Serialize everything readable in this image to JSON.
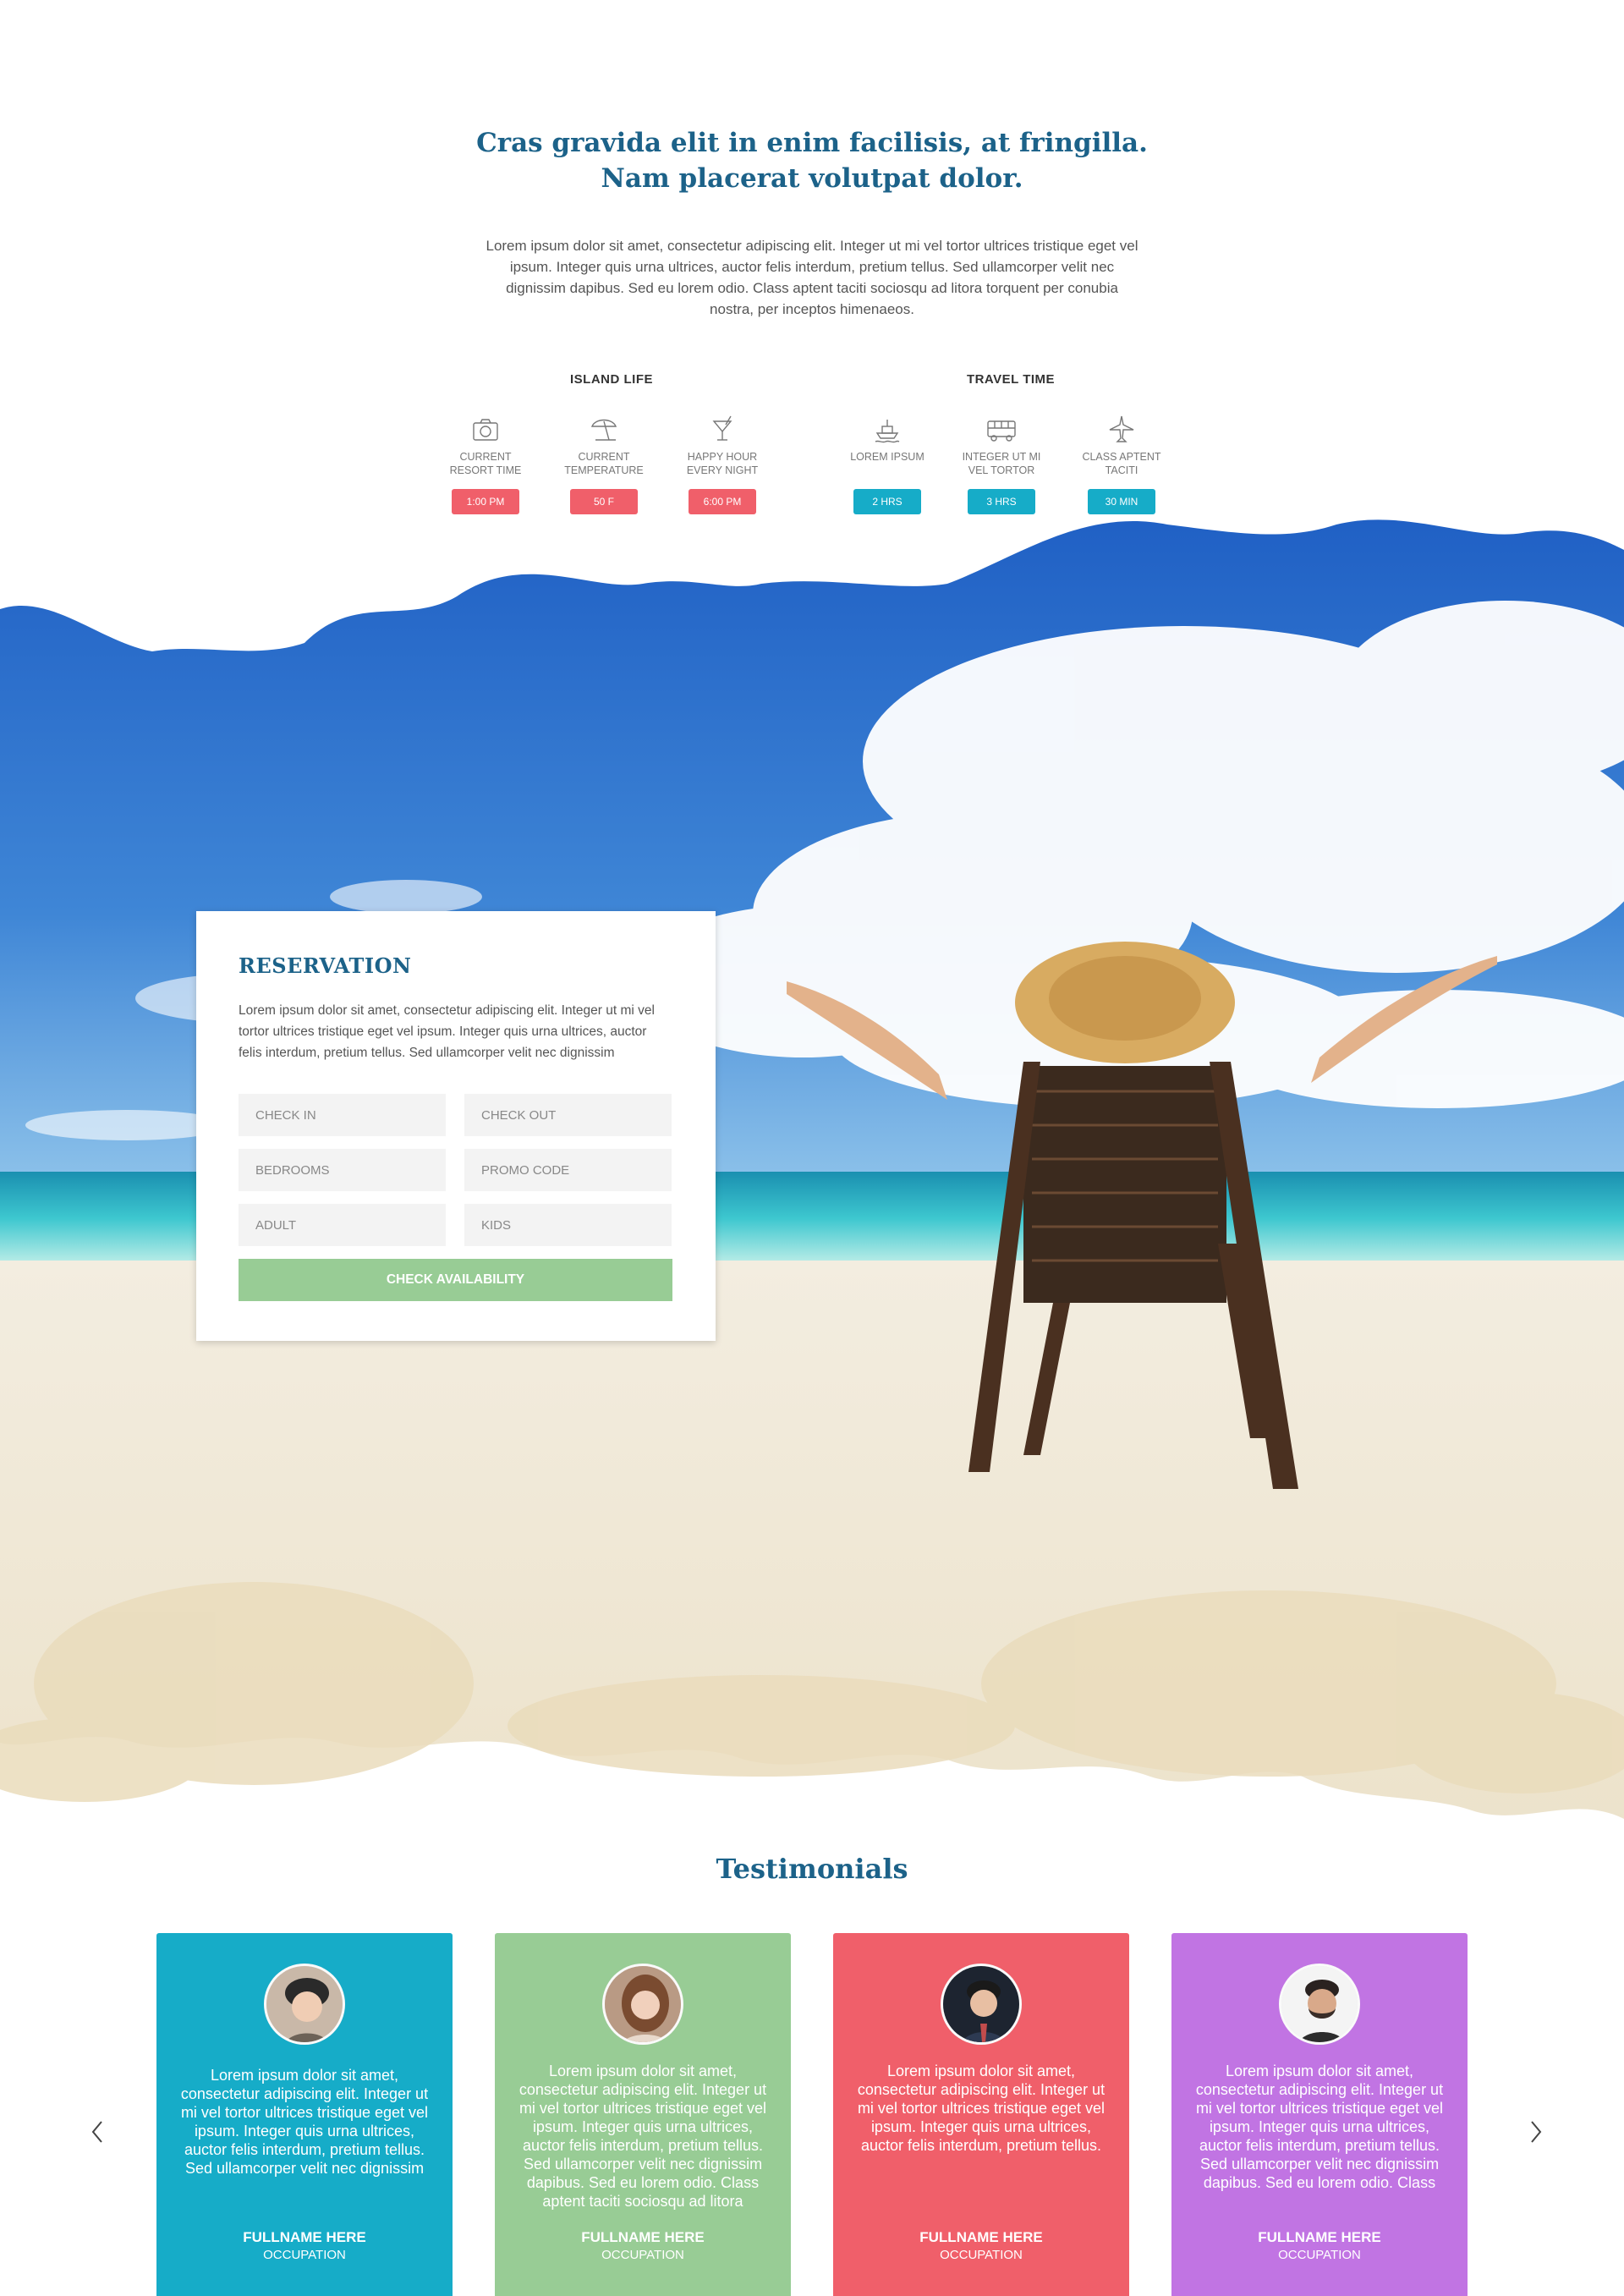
{
  "intro": {
    "title_line1": "Cras gravida elit in enim facilisis, at fringilla.",
    "title_line2": "Nam placerat volutpat dolor.",
    "text": "Lorem ipsum dolor sit amet, consectetur adipiscing elit. Integer ut mi vel tortor ultrices tristique eget vel ipsum. Integer quis urna ultrices, auctor felis interdum, pretium tellus. Sed ullamcorper velit nec dignissim dapibus. Sed eu lorem odio. Class aptent taciti sociosqu ad litora torquent per conubia nostra, per inceptos himenaeos."
  },
  "island_life": {
    "title": "ISLAND LIFE",
    "items": [
      {
        "icon": "camera-icon",
        "label": "CURRENT RESORT TIME",
        "value": "1:00 PM"
      },
      {
        "icon": "beach-umbrella-icon",
        "label": "CURRENT TEMPERATURE",
        "value": "50 F"
      },
      {
        "icon": "cocktail-icon",
        "label": "HAPPY HOUR EVERY NIGHT",
        "value": "6:00 PM"
      }
    ]
  },
  "travel_time": {
    "title": "TRAVEL TIME",
    "items": [
      {
        "icon": "ship-icon",
        "label": "LOREM IPSUM",
        "value": "2 HRS"
      },
      {
        "icon": "bus-icon",
        "label": "INTEGER UT MI VEL TORTOR",
        "value": "3 HRS"
      },
      {
        "icon": "airplane-icon",
        "label": "CLASS APTENT TACITI",
        "value": "30 MIN"
      }
    ]
  },
  "reservation": {
    "title": "RESERVATION",
    "text": "Lorem ipsum dolor sit amet, consectetur adipiscing elit. Integer ut mi vel tortor ultrices tristique eget vel ipsum. Integer quis urna ultrices, auctor felis interdum, pretium tellus. Sed ullamcorper velit nec dignissim",
    "fields": {
      "check_in": "CHECK IN",
      "check_out": "CHECK OUT",
      "bedrooms": "BEDROOMS",
      "promo_code": "PROMO CODE",
      "adult": "ADULT",
      "kids": "KIDS"
    },
    "button": "CHECK AVAILABILITY"
  },
  "testimonials": {
    "title": "Testimonials",
    "cards": [
      {
        "color": "#16acc8",
        "quote": "Lorem ipsum dolor sit amet, consectetur adipiscing elit. Integer ut mi vel tortor ultrices tristique eget vel ipsum. Integer quis urna ultrices, auctor felis interdum, pretium tellus. Sed ullamcorper velit nec dignissim",
        "name": "FULLNAME HERE",
        "occupation": "OCCUPATION"
      },
      {
        "color": "#98cc95",
        "quote": "Lorem ipsum dolor sit amet, consectetur adipiscing elit. Integer ut mi vel tortor ultrices tristique eget vel ipsum. Integer quis urna ultrices, auctor felis interdum, pretium tellus. Sed ullamcorper velit nec dignissim dapibus. Sed eu lorem odio. Class aptent taciti sociosqu ad litora",
        "name": "FULLNAME HERE",
        "occupation": "OCCUPATION"
      },
      {
        "color": "#f05f6a",
        "quote": "Lorem ipsum dolor sit amet, consectetur adipiscing elit. Integer ut mi vel tortor ultrices tristique eget vel ipsum. Integer quis urna ultrices, auctor felis interdum, pretium tellus.",
        "name": "FULLNAME HERE",
        "occupation": "OCCUPATION"
      },
      {
        "color": "#c174e3",
        "quote": "Lorem ipsum dolor sit amet, consectetur adipiscing elit. Integer ut mi vel tortor ultrices tristique eget vel ipsum. Integer quis urna ultrices, auctor felis interdum, pretium tellus. Sed ullamcorper velit nec dignissim dapibus. Sed eu lorem odio. Class",
        "name": "FULLNAME HERE",
        "occupation": "OCCUPATION"
      }
    ],
    "prev_icon": "chevron-left-icon",
    "next_icon": "chevron-right-icon"
  },
  "colors": {
    "heading": "#1c6289",
    "badge_red": "#f05f6a",
    "badge_teal": "#16acc8",
    "button_green": "#98cc95"
  }
}
